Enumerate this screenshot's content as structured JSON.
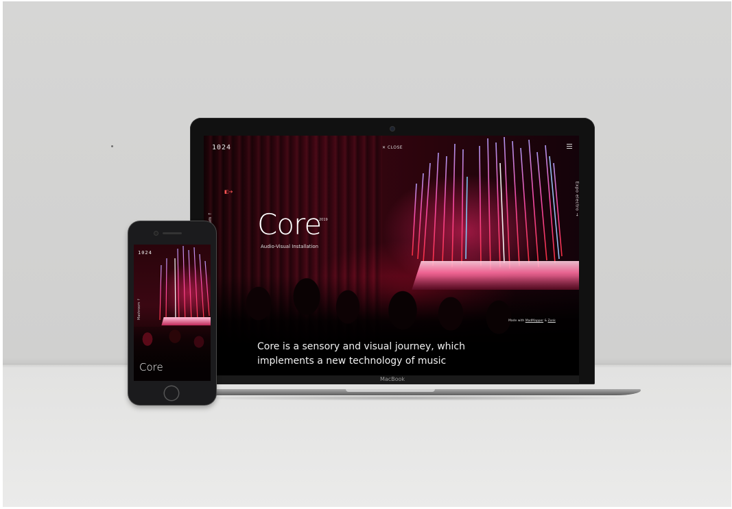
{
  "laptop": {
    "brand": "MacBook",
    "site": {
      "logo": "1024",
      "close_label": "✕  CLOSE",
      "side_left": "Mashroom ↑",
      "side_right": "Expo electro →",
      "title": "Core",
      "year": "2019",
      "subtitle": "Audio-Visual Installation",
      "credit_prefix": "Made with ",
      "credit_tool": "MadMapper",
      "credit_and": " & ",
      "credit_partner": "Zonk",
      "description": "Core is a sensory and visual journey, which implements a new technology of music"
    }
  },
  "phone": {
    "logo": "1024",
    "side": "Mashroom ↑",
    "title": "Core"
  },
  "colors": {
    "background_wall": "#d6d6d5",
    "accent_neon": "#ff3d8a",
    "screen_text": "#ffffff"
  },
  "icons": [
    "close-icon",
    "hamburger-menu-icon",
    "side-nav-icon",
    "home-button-icon"
  ]
}
